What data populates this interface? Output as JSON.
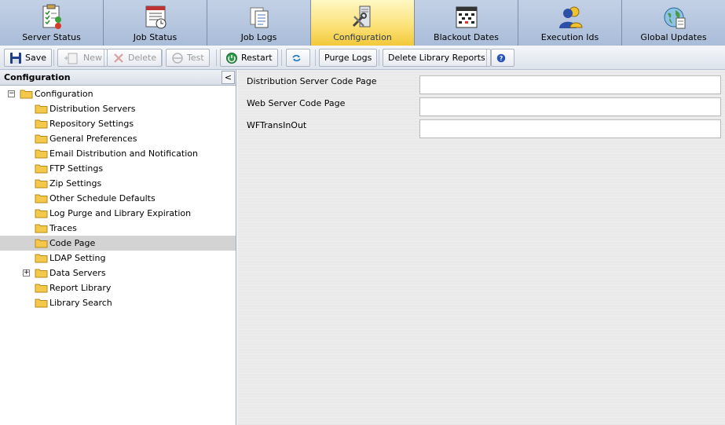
{
  "tabs": [
    {
      "label": "Server Status",
      "icon": "server-status-icon",
      "active": false
    },
    {
      "label": "Job Status",
      "icon": "job-status-icon",
      "active": false
    },
    {
      "label": "Job Logs",
      "icon": "job-logs-icon",
      "active": false
    },
    {
      "label": "Configuration",
      "icon": "configuration-icon",
      "active": true
    },
    {
      "label": "Blackout Dates",
      "icon": "calendar-icon",
      "active": false
    },
    {
      "label": "Execution Ids",
      "icon": "execution-ids-icon",
      "active": false
    },
    {
      "label": "Global Updates",
      "icon": "global-updates-icon",
      "active": false
    }
  ],
  "toolbar": {
    "save": "Save",
    "new": "New",
    "delete": "Delete",
    "test": "Test",
    "restart": "Restart",
    "purge_logs": "Purge Logs",
    "delete_library_reports": "Delete Library Reports"
  },
  "left_panel": {
    "title": "Configuration",
    "collapse_glyph": "<",
    "tree": {
      "root": "Configuration",
      "items": [
        {
          "label": "Distribution Servers"
        },
        {
          "label": "Repository Settings"
        },
        {
          "label": "General Preferences"
        },
        {
          "label": "Email Distribution and Notification"
        },
        {
          "label": "FTP Settings"
        },
        {
          "label": "Zip Settings"
        },
        {
          "label": "Other Schedule Defaults"
        },
        {
          "label": "Log Purge and Library Expiration"
        },
        {
          "label": "Traces"
        },
        {
          "label": "Code Page",
          "selected": true
        },
        {
          "label": "LDAP Setting"
        },
        {
          "label": "Data Servers",
          "expandable": true
        },
        {
          "label": "Report Library"
        },
        {
          "label": "Library Search"
        }
      ]
    }
  },
  "form": {
    "fields": [
      {
        "label": "Distribution Server Code Page",
        "value": ""
      },
      {
        "label": "Web Server Code Page",
        "value": ""
      },
      {
        "label": "WFTransInOut",
        "value": ""
      }
    ]
  },
  "colors": {
    "active_tab": "#fbe27a",
    "tab_bg": "#a9bcd8",
    "selected_node": "#d3d3d3",
    "folder": "#f4c84a"
  }
}
